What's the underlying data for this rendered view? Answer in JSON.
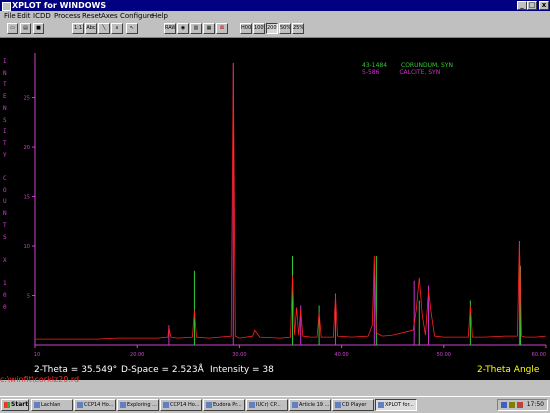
{
  "window": {
    "title": "XPLOT for WINDOWS",
    "controls": [
      "_",
      "□",
      "x"
    ]
  },
  "menu": [
    "File",
    "Edit",
    "ICDD",
    "Process",
    "Reset",
    "Axes",
    "Configure",
    "Help"
  ],
  "toolbar": {
    "buttons": [
      "new",
      "open",
      "save",
      "1:1",
      "Abc",
      "",
      "",
      "",
      "",
      "RAW",
      "",
      "",
      "",
      "",
      "",
      "",
      "",
      "H00",
      "100%",
      "200%",
      "50%",
      "25%"
    ]
  },
  "plot": {
    "y_axis_letters": [
      "I",
      "N",
      "T",
      "E",
      "N",
      "S",
      "I",
      "T",
      "Y",
      "",
      "C",
      "O",
      "U",
      "N",
      "T",
      "S",
      "",
      "X",
      "",
      "1",
      "0",
      "0"
    ],
    "y_ticks": [
      "25",
      "20",
      "15",
      "10",
      "5"
    ],
    "x_ticks": [
      "10",
      "20.00",
      "30.00",
      "40.00",
      "50.00",
      "60.00"
    ],
    "legend": [
      {
        "code": "43-1484",
        "name": "CORUNDUM, SYN",
        "color": "#33cc33"
      },
      {
        "code": "5-586",
        "name": "CALCITE, SYN",
        "color": "#cc33cc"
      }
    ],
    "readout": {
      "two_theta": "2-Theta = 35.549°",
      "d_space": "D-Space = 2.523Å",
      "intensity": "Intensity = 38"
    },
    "x_title": "2-Theta Angle",
    "filename": "c:\\winfit\\corklz20.rd"
  },
  "chart_data": {
    "type": "line",
    "xlabel": "2-Theta Angle",
    "ylabel": "INTENSITY COUNTS X 100",
    "xlim": [
      10,
      60
    ],
    "ylim": [
      0,
      29
    ],
    "series": [
      {
        "name": "",
        "color": "#ff2222",
        "x": [
          10,
          12,
          14,
          16,
          18,
          20,
          22,
          23.0,
          23.1,
          23.3,
          24,
          25.4,
          25.6,
          25.8,
          27,
          29.2,
          29.4,
          29.6,
          30,
          31.3,
          31.5,
          32,
          34,
          35.0,
          35.2,
          35.4,
          35.6,
          35.8,
          36.0,
          36.2,
          37,
          37.6,
          37.8,
          38.0,
          39.2,
          39.4,
          39.6,
          41,
          42.6,
          43.0,
          43.2,
          43.4,
          44,
          45,
          47.0,
          47.3,
          47.6,
          47.9,
          48.2,
          48.5,
          48.8,
          49.1,
          50,
          52.4,
          52.6,
          52.8,
          54,
          56,
          57.2,
          57.4,
          57.6,
          58,
          59,
          60
        ],
        "values": [
          0.6,
          0.6,
          0.6,
          0.6,
          0.7,
          0.7,
          0.7,
          0.8,
          1.8,
          0.8,
          0.7,
          0.8,
          3.5,
          0.8,
          0.7,
          0.9,
          28.5,
          0.9,
          0.7,
          0.9,
          1.5,
          0.8,
          0.7,
          0.8,
          7.0,
          1.0,
          3.8,
          1.0,
          3.6,
          0.9,
          0.8,
          0.8,
          3.3,
          0.8,
          0.8,
          5.0,
          0.9,
          0.8,
          0.9,
          2.0,
          9.0,
          1.2,
          0.9,
          1.0,
          1.5,
          3.5,
          6.8,
          3.0,
          1.0,
          5.5,
          3.0,
          0.9,
          0.8,
          0.8,
          4.0,
          0.8,
          0.8,
          0.9,
          0.9,
          10.5,
          0.9,
          0.8,
          0.8,
          0.9
        ]
      }
    ],
    "sticks": [
      {
        "name": "CORUNDUM, SYN",
        "color": "#33cc33",
        "x": [
          25.6,
          35.2,
          37.8,
          43.4,
          47.6,
          52.6,
          57.5
        ],
        "values": [
          7.5,
          9.0,
          4.0,
          9.0,
          4.5,
          4.5,
          8.0
        ]
      },
      {
        "name": "CALCITE, SYN",
        "color": "#cc33cc",
        "x": [
          23.1,
          29.4,
          36.0,
          39.4,
          43.2,
          47.1,
          48.5,
          57.4
        ],
        "values": [
          2.0,
          28.5,
          4.0,
          5.2,
          8.0,
          6.5,
          6.0,
          10.5
        ]
      }
    ]
  },
  "taskbar": {
    "start": "Start",
    "tasks": [
      "Lachlan",
      "CCP14 Ho...",
      "Exploring ...",
      "CCP14 Ho...",
      "Eudora Pr...",
      "IUCr) CP...",
      "Article 19 ...",
      "CD Player",
      "XPLOT for..."
    ],
    "active_task": 8,
    "clock": "17:50"
  }
}
